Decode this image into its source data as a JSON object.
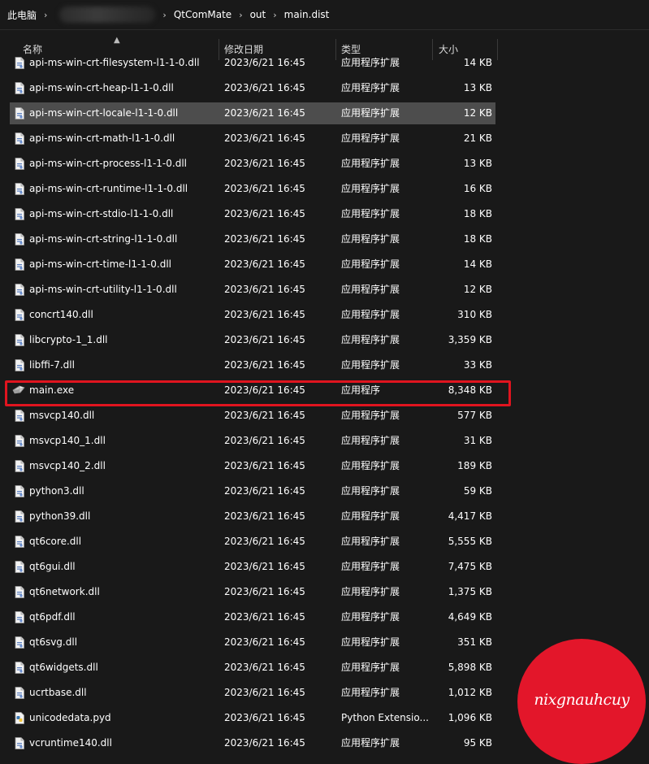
{
  "breadcrumb": {
    "root": "此电脑",
    "separator": "›",
    "segments": [
      "QtComMate",
      "out",
      "main.dist"
    ]
  },
  "columns": {
    "name": "名称",
    "date": "修改日期",
    "type": "类型",
    "size": "大小"
  },
  "icons": {
    "sort": "sort-up-icon",
    "dll": "dll-file-icon",
    "exe": "exe-app-icon",
    "pyd": "python-file-icon"
  },
  "files": [
    {
      "name": "api-ms-win-crt-filesystem-l1-1-0.dll",
      "date": "2023/6/21 16:45",
      "type": "应用程序扩展",
      "size": "14 KB",
      "icon": "dll"
    },
    {
      "name": "api-ms-win-crt-heap-l1-1-0.dll",
      "date": "2023/6/21 16:45",
      "type": "应用程序扩展",
      "size": "13 KB",
      "icon": "dll"
    },
    {
      "name": "api-ms-win-crt-locale-l1-1-0.dll",
      "date": "2023/6/21 16:45",
      "type": "应用程序扩展",
      "size": "12 KB",
      "icon": "dll"
    },
    {
      "name": "api-ms-win-crt-math-l1-1-0.dll",
      "date": "2023/6/21 16:45",
      "type": "应用程序扩展",
      "size": "21 KB",
      "icon": "dll"
    },
    {
      "name": "api-ms-win-crt-process-l1-1-0.dll",
      "date": "2023/6/21 16:45",
      "type": "应用程序扩展",
      "size": "13 KB",
      "icon": "dll"
    },
    {
      "name": "api-ms-win-crt-runtime-l1-1-0.dll",
      "date": "2023/6/21 16:45",
      "type": "应用程序扩展",
      "size": "16 KB",
      "icon": "dll"
    },
    {
      "name": "api-ms-win-crt-stdio-l1-1-0.dll",
      "date": "2023/6/21 16:45",
      "type": "应用程序扩展",
      "size": "18 KB",
      "icon": "dll"
    },
    {
      "name": "api-ms-win-crt-string-l1-1-0.dll",
      "date": "2023/6/21 16:45",
      "type": "应用程序扩展",
      "size": "18 KB",
      "icon": "dll"
    },
    {
      "name": "api-ms-win-crt-time-l1-1-0.dll",
      "date": "2023/6/21 16:45",
      "type": "应用程序扩展",
      "size": "14 KB",
      "icon": "dll"
    },
    {
      "name": "api-ms-win-crt-utility-l1-1-0.dll",
      "date": "2023/6/21 16:45",
      "type": "应用程序扩展",
      "size": "12 KB",
      "icon": "dll"
    },
    {
      "name": "concrt140.dll",
      "date": "2023/6/21 16:45",
      "type": "应用程序扩展",
      "size": "310 KB",
      "icon": "dll"
    },
    {
      "name": "libcrypto-1_1.dll",
      "date": "2023/6/21 16:45",
      "type": "应用程序扩展",
      "size": "3,359 KB",
      "icon": "dll"
    },
    {
      "name": "libffi-7.dll",
      "date": "2023/6/21 16:45",
      "type": "应用程序扩展",
      "size": "33 KB",
      "icon": "dll"
    },
    {
      "name": "main.exe",
      "date": "2023/6/21 16:45",
      "type": "应用程序",
      "size": "8,348 KB",
      "icon": "exe"
    },
    {
      "name": "msvcp140.dll",
      "date": "2023/6/21 16:45",
      "type": "应用程序扩展",
      "size": "577 KB",
      "icon": "dll"
    },
    {
      "name": "msvcp140_1.dll",
      "date": "2023/6/21 16:45",
      "type": "应用程序扩展",
      "size": "31 KB",
      "icon": "dll"
    },
    {
      "name": "msvcp140_2.dll",
      "date": "2023/6/21 16:45",
      "type": "应用程序扩展",
      "size": "189 KB",
      "icon": "dll"
    },
    {
      "name": "python3.dll",
      "date": "2023/6/21 16:45",
      "type": "应用程序扩展",
      "size": "59 KB",
      "icon": "dll"
    },
    {
      "name": "python39.dll",
      "date": "2023/6/21 16:45",
      "type": "应用程序扩展",
      "size": "4,417 KB",
      "icon": "dll"
    },
    {
      "name": "qt6core.dll",
      "date": "2023/6/21 16:45",
      "type": "应用程序扩展",
      "size": "5,555 KB",
      "icon": "dll"
    },
    {
      "name": "qt6gui.dll",
      "date": "2023/6/21 16:45",
      "type": "应用程序扩展",
      "size": "7,475 KB",
      "icon": "dll"
    },
    {
      "name": "qt6network.dll",
      "date": "2023/6/21 16:45",
      "type": "应用程序扩展",
      "size": "1,375 KB",
      "icon": "dll"
    },
    {
      "name": "qt6pdf.dll",
      "date": "2023/6/21 16:45",
      "type": "应用程序扩展",
      "size": "4,649 KB",
      "icon": "dll"
    },
    {
      "name": "qt6svg.dll",
      "date": "2023/6/21 16:45",
      "type": "应用程序扩展",
      "size": "351 KB",
      "icon": "dll"
    },
    {
      "name": "qt6widgets.dll",
      "date": "2023/6/21 16:45",
      "type": "应用程序扩展",
      "size": "5,898 KB",
      "icon": "dll"
    },
    {
      "name": "ucrtbase.dll",
      "date": "2023/6/21 16:45",
      "type": "应用程序扩展",
      "size": "1,012 KB",
      "icon": "dll"
    },
    {
      "name": "unicodedata.pyd",
      "date": "2023/6/21 16:45",
      "type": "Python Extensio...",
      "size": "1,096 KB",
      "icon": "pyd"
    },
    {
      "name": "vcruntime140.dll",
      "date": "2023/6/21 16:45",
      "type": "应用程序扩展",
      "size": "95 KB",
      "icon": "dll"
    }
  ],
  "selected_index": 2,
  "highlighted_index": 13,
  "colors": {
    "background": "#191919",
    "selection": "#4d4d4d",
    "highlight_box": "#e0141f",
    "stamp": "#e3162a"
  },
  "watermark": {
    "text": "nixgnauhcuy"
  }
}
